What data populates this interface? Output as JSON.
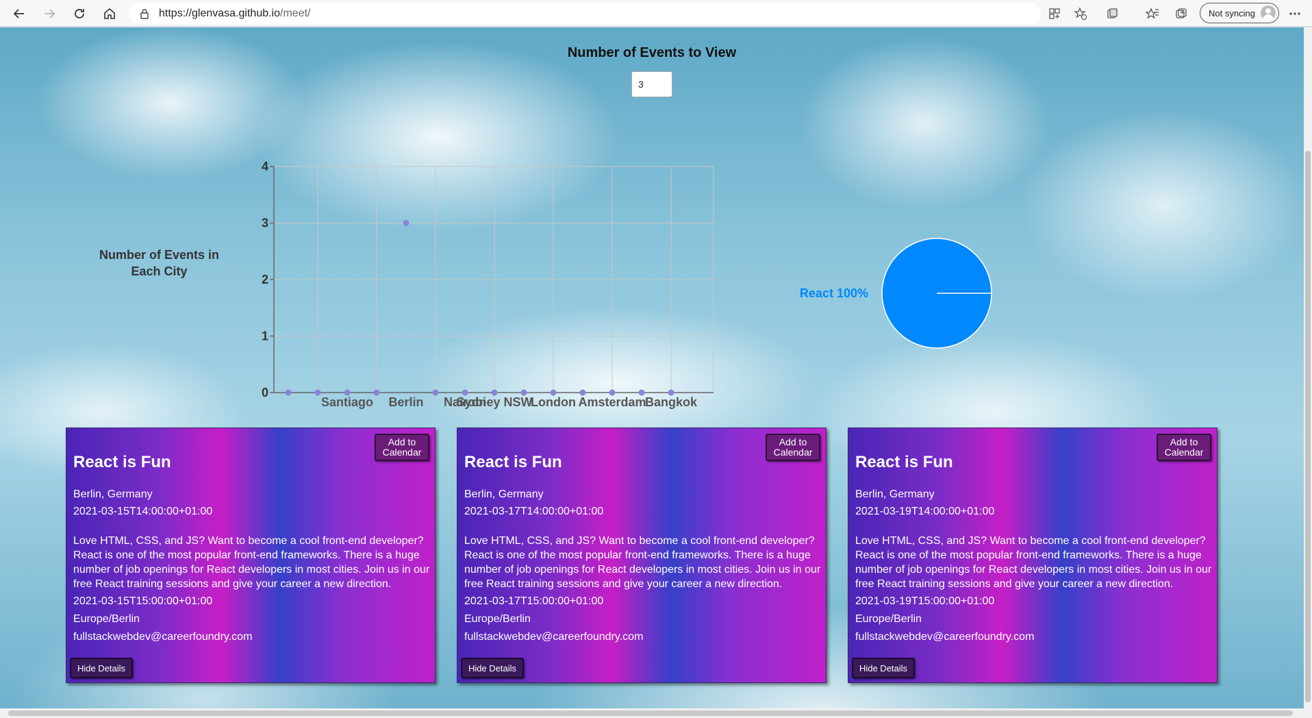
{
  "browser": {
    "url_prefix": "https://glenvasa.github.io",
    "url_path": "/meet/",
    "profile_label": "Not syncing",
    "icons": [
      "back-arrow-icon",
      "forward-arrow-icon",
      "refresh-icon",
      "home-icon",
      "lock-icon",
      "app-available-icon",
      "favorites-add-icon",
      "extensions-icon",
      "favorites-icon",
      "collections-icon",
      "more-icon"
    ]
  },
  "events_control": {
    "title": "Number of Events to View",
    "value": "3"
  },
  "scatter": {
    "side_label": "Number of Events in Each City"
  },
  "pie": {
    "label": "React 100%"
  },
  "colors": {
    "point": "#8884d8",
    "pie": "#0088fe",
    "pie_label": "#0088fe"
  },
  "chart_data": [
    {
      "type": "scatter",
      "title": "",
      "xlabel": "",
      "ylabel": "",
      "ylim": [
        0,
        4
      ],
      "yticks": [
        0,
        1,
        2,
        3,
        4
      ],
      "grid": true,
      "categories": [
        "",
        "",
        "Santiago",
        "",
        "Berlin",
        "",
        "Nairobi",
        "Sydney NSW",
        "",
        "London",
        "",
        "Amsterdam",
        "",
        "Bangkok"
      ],
      "tick_labels_shown": [
        "Santiago",
        "Berlin",
        "Nairobi",
        "Sydney NSW",
        "London",
        "Amsterdam",
        "Bangkok"
      ],
      "values": [
        0,
        0,
        0,
        0,
        3,
        0,
        0,
        0,
        0,
        0,
        0,
        0,
        0,
        0
      ]
    },
    {
      "type": "pie",
      "labels": [
        "React"
      ],
      "values": [
        100
      ],
      "data_labels": [
        "React 100%"
      ]
    }
  ],
  "events": [
    {
      "title": "React is Fun",
      "add_to_calendar": "Add to Calendar",
      "location": "Berlin, Germany",
      "start": "2021-03-15T14:00:00+01:00",
      "description": "Love HTML, CSS, and JS? Want to become a cool front-end developer? React is one of the most popular front-end frameworks. There is a huge number of job openings for React developers in most cities. Join us in our free React training sessions and give your career a new direction.",
      "end": "2021-03-15T15:00:00+01:00",
      "timezone": "Europe/Berlin",
      "email": "fullstackwebdev@careerfoundry.com",
      "hide_details": "Hide Details"
    },
    {
      "title": "React is Fun",
      "add_to_calendar": "Add to Calendar",
      "location": "Berlin, Germany",
      "start": "2021-03-17T14:00:00+01:00",
      "description": "Love HTML, CSS, and JS? Want to become a cool front-end developer? React is one of the most popular front-end frameworks. There is a huge number of job openings for React developers in most cities. Join us in our free React training sessions and give your career a new direction.",
      "end": "2021-03-17T15:00:00+01:00",
      "timezone": "Europe/Berlin",
      "email": "fullstackwebdev@careerfoundry.com",
      "hide_details": "Hide Details"
    },
    {
      "title": "React is Fun",
      "add_to_calendar": "Add to Calendar",
      "location": "Berlin, Germany",
      "start": "2021-03-19T14:00:00+01:00",
      "description": "Love HTML, CSS, and JS? Want to become a cool front-end developer? React is one of the most popular front-end frameworks. There is a huge number of job openings for React developers in most cities. Join us in our free React training sessions and give your career a new direction.",
      "end": "2021-03-19T15:00:00+01:00",
      "timezone": "Europe/Berlin",
      "email": "fullstackwebdev@careerfoundry.com",
      "hide_details": "Hide Details"
    }
  ]
}
